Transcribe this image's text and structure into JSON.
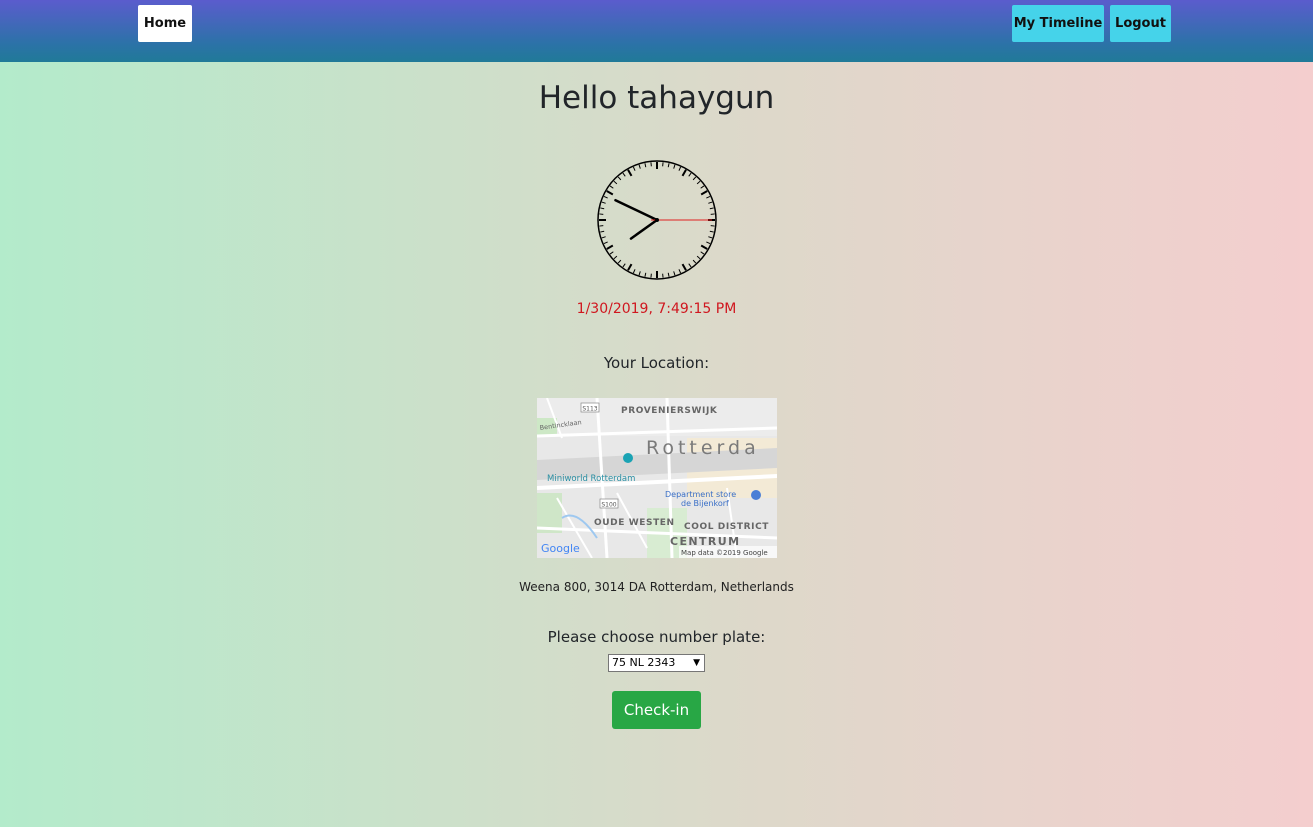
{
  "nav": {
    "home_label": "Home",
    "timeline_label": "My Timeline",
    "logout_label": "Logout"
  },
  "greeting": "Hello tahaygun",
  "clock": {
    "time": "7:49:15"
  },
  "datetime": "1/30/2019, 7:49:15 PM",
  "location": {
    "label": "Your Location:",
    "address": "Weena 800, 3014 DA Rotterdam, Netherlands",
    "map": {
      "labels": {
        "s113": "S113",
        "provenierswijk": "PROVENIERSWIJK",
        "bentincklaan": "Bentincklaan",
        "rotterdam": "Rotterda",
        "miniworld": "Miniworld Rotterdam",
        "s100": "S100",
        "dept_store_1": "Department store",
        "dept_store_2": "de Bijenkorf",
        "oude_westen": "OUDE WESTEN",
        "cool_district": "COOL DISTRICT",
        "centrum": "CENTRUM",
        "google": "Google",
        "attribution": "Map data ©2019 Google"
      }
    }
  },
  "plate": {
    "label": "Please choose number plate:",
    "selected": "75 NL 2343"
  },
  "checkin_label": "Check-in",
  "colors": {
    "nav_btn": "#45d3ea",
    "checkin": "#28a745",
    "datetime": "#d0171f"
  }
}
